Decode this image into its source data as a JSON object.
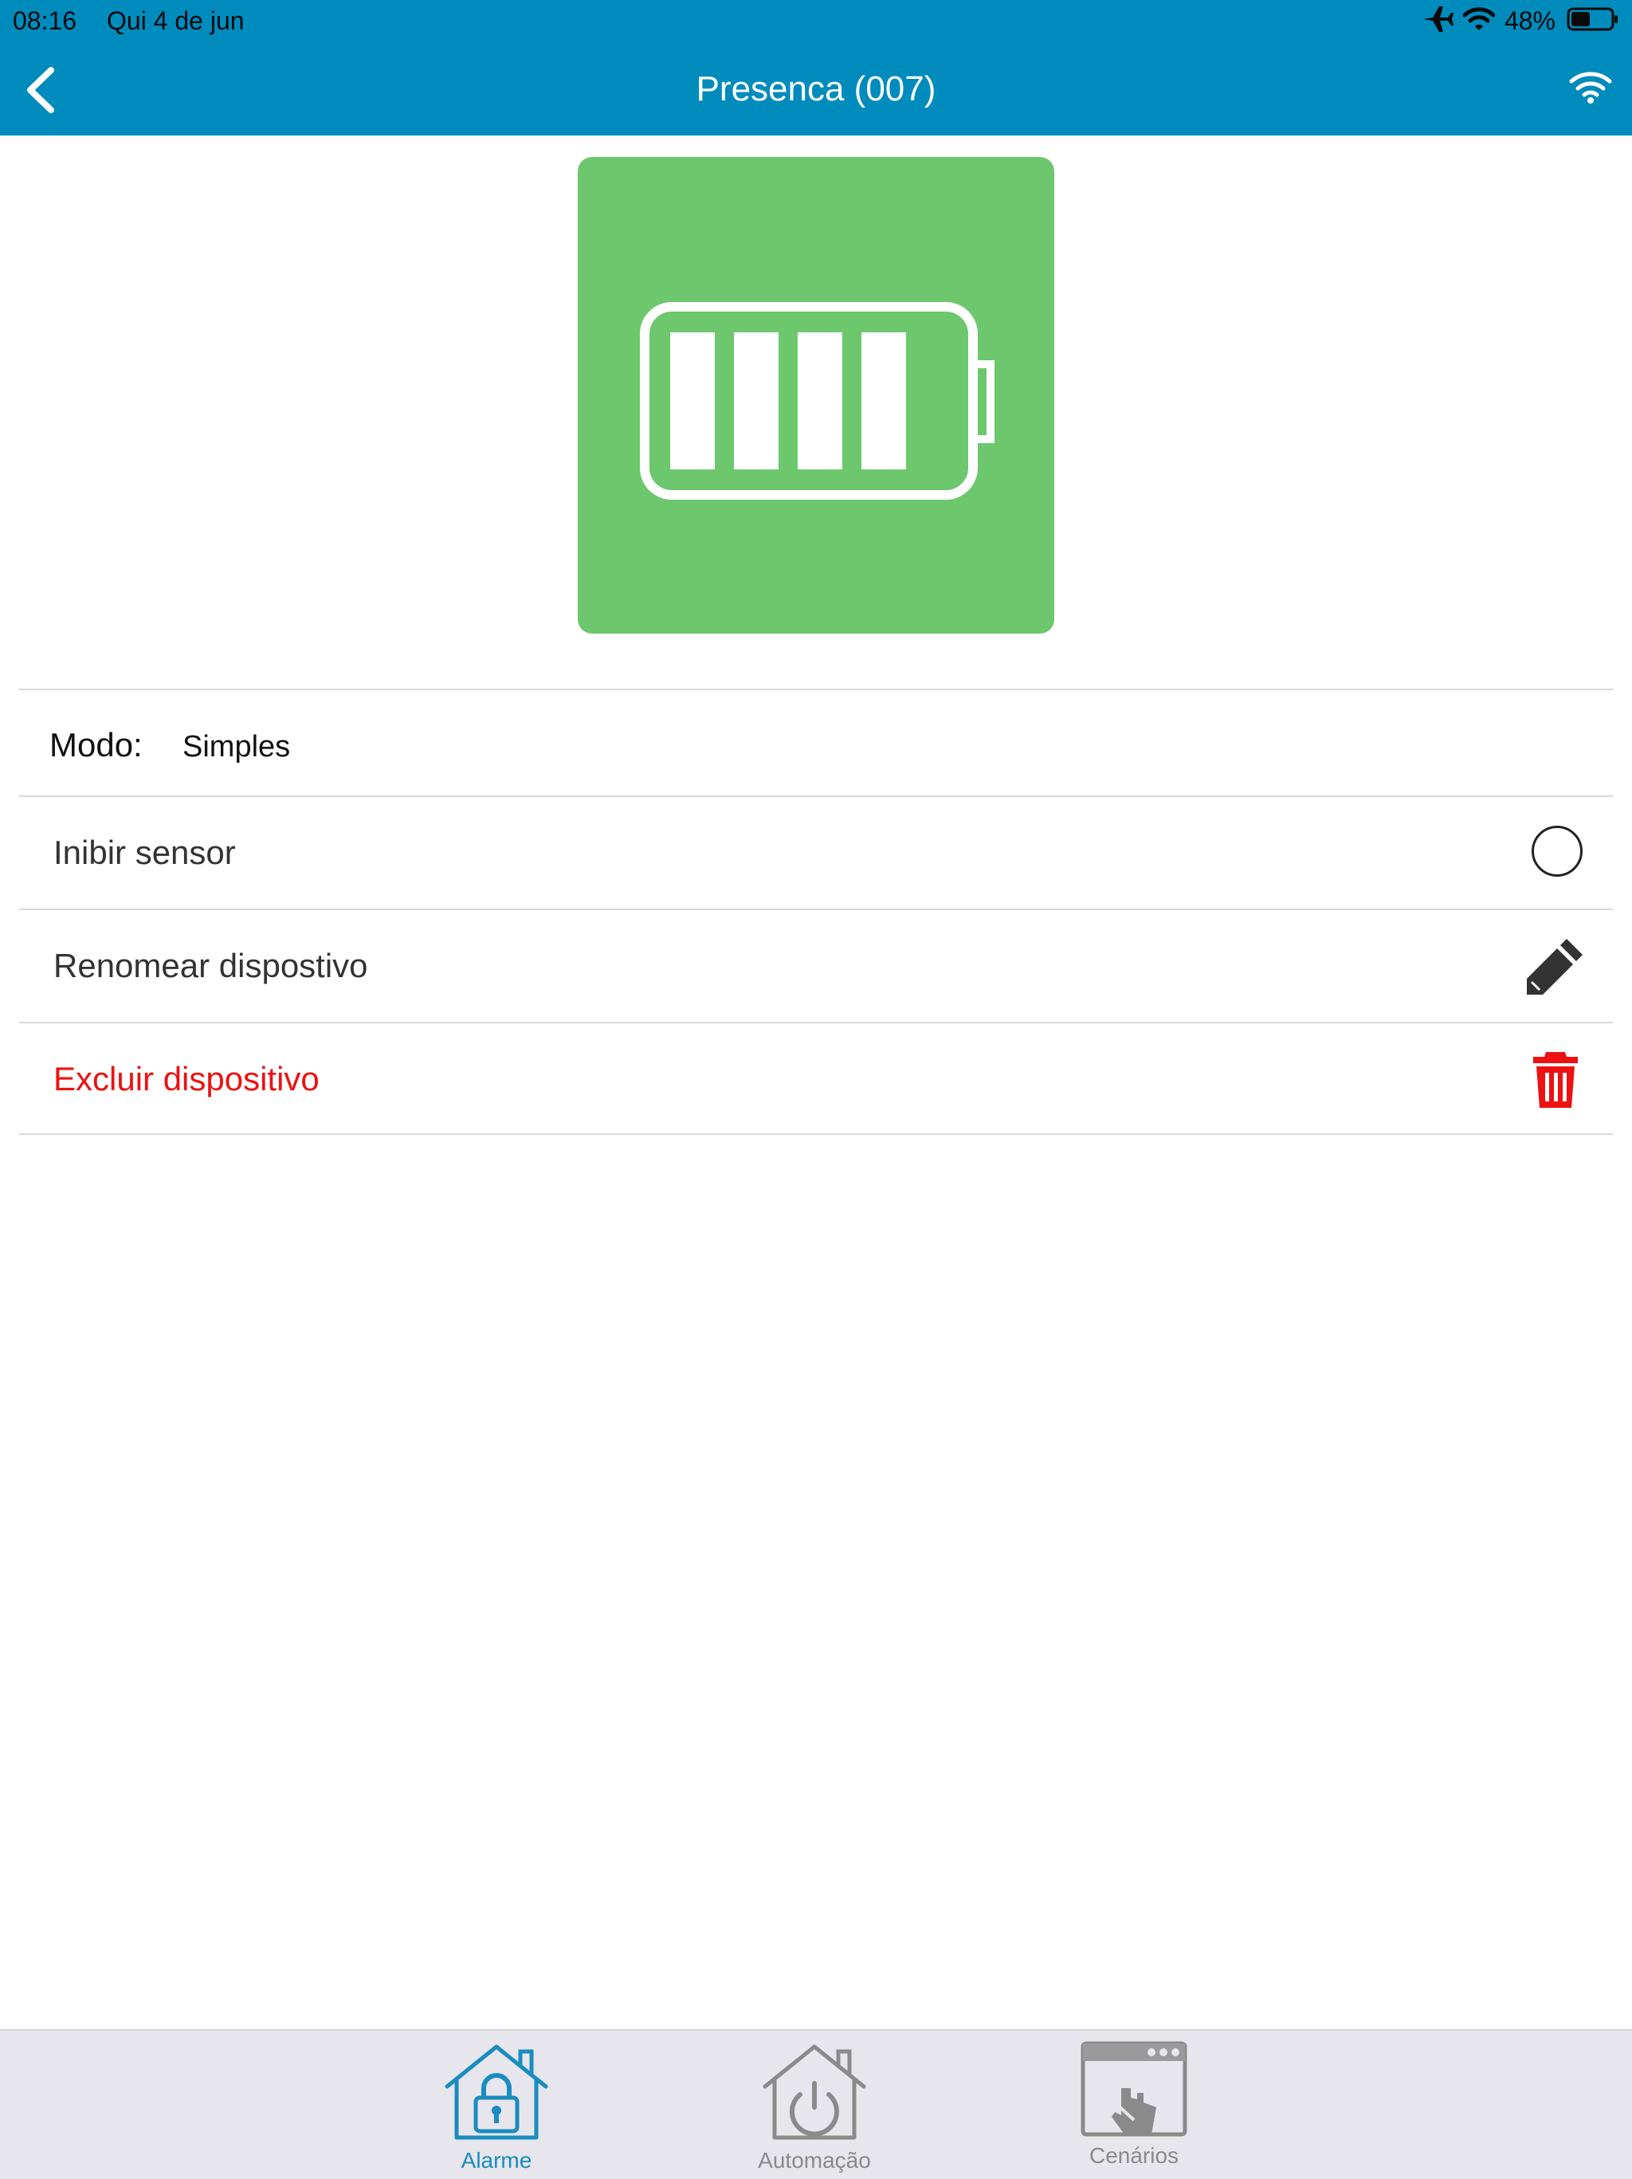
{
  "status_bar": {
    "time": "08:16",
    "date": "Qui 4 de jun",
    "battery_percent": "48%",
    "battery_level": 0.48,
    "icons": [
      "airplane-icon",
      "wifi-icon",
      "battery-icon"
    ]
  },
  "nav": {
    "title": "Presenca (007)",
    "back_icon": "chevron-left-icon",
    "connection_icon": "wifi-icon"
  },
  "device": {
    "icon": "battery-full-icon",
    "battery_bars": 4,
    "tile_color": "#6cc76d"
  },
  "settings": {
    "mode_label": "Modo:",
    "mode_value": "Simples",
    "inhibit_label": "Inibir sensor",
    "inhibit_checked": false,
    "rename_label": "Renomear dispostivo",
    "delete_label": "Excluir dispositivo"
  },
  "tabs": [
    {
      "label": "Alarme",
      "icon": "house-lock-icon",
      "active": true
    },
    {
      "label": "Automação",
      "icon": "house-power-icon",
      "active": false
    },
    {
      "label": "Cenários",
      "icon": "window-touch-icon",
      "active": false
    }
  ],
  "colors": {
    "header": "#008bbd",
    "accent": "#1a8cbf",
    "danger": "#ee1111",
    "inactive_tab": "#8a8a8a"
  }
}
